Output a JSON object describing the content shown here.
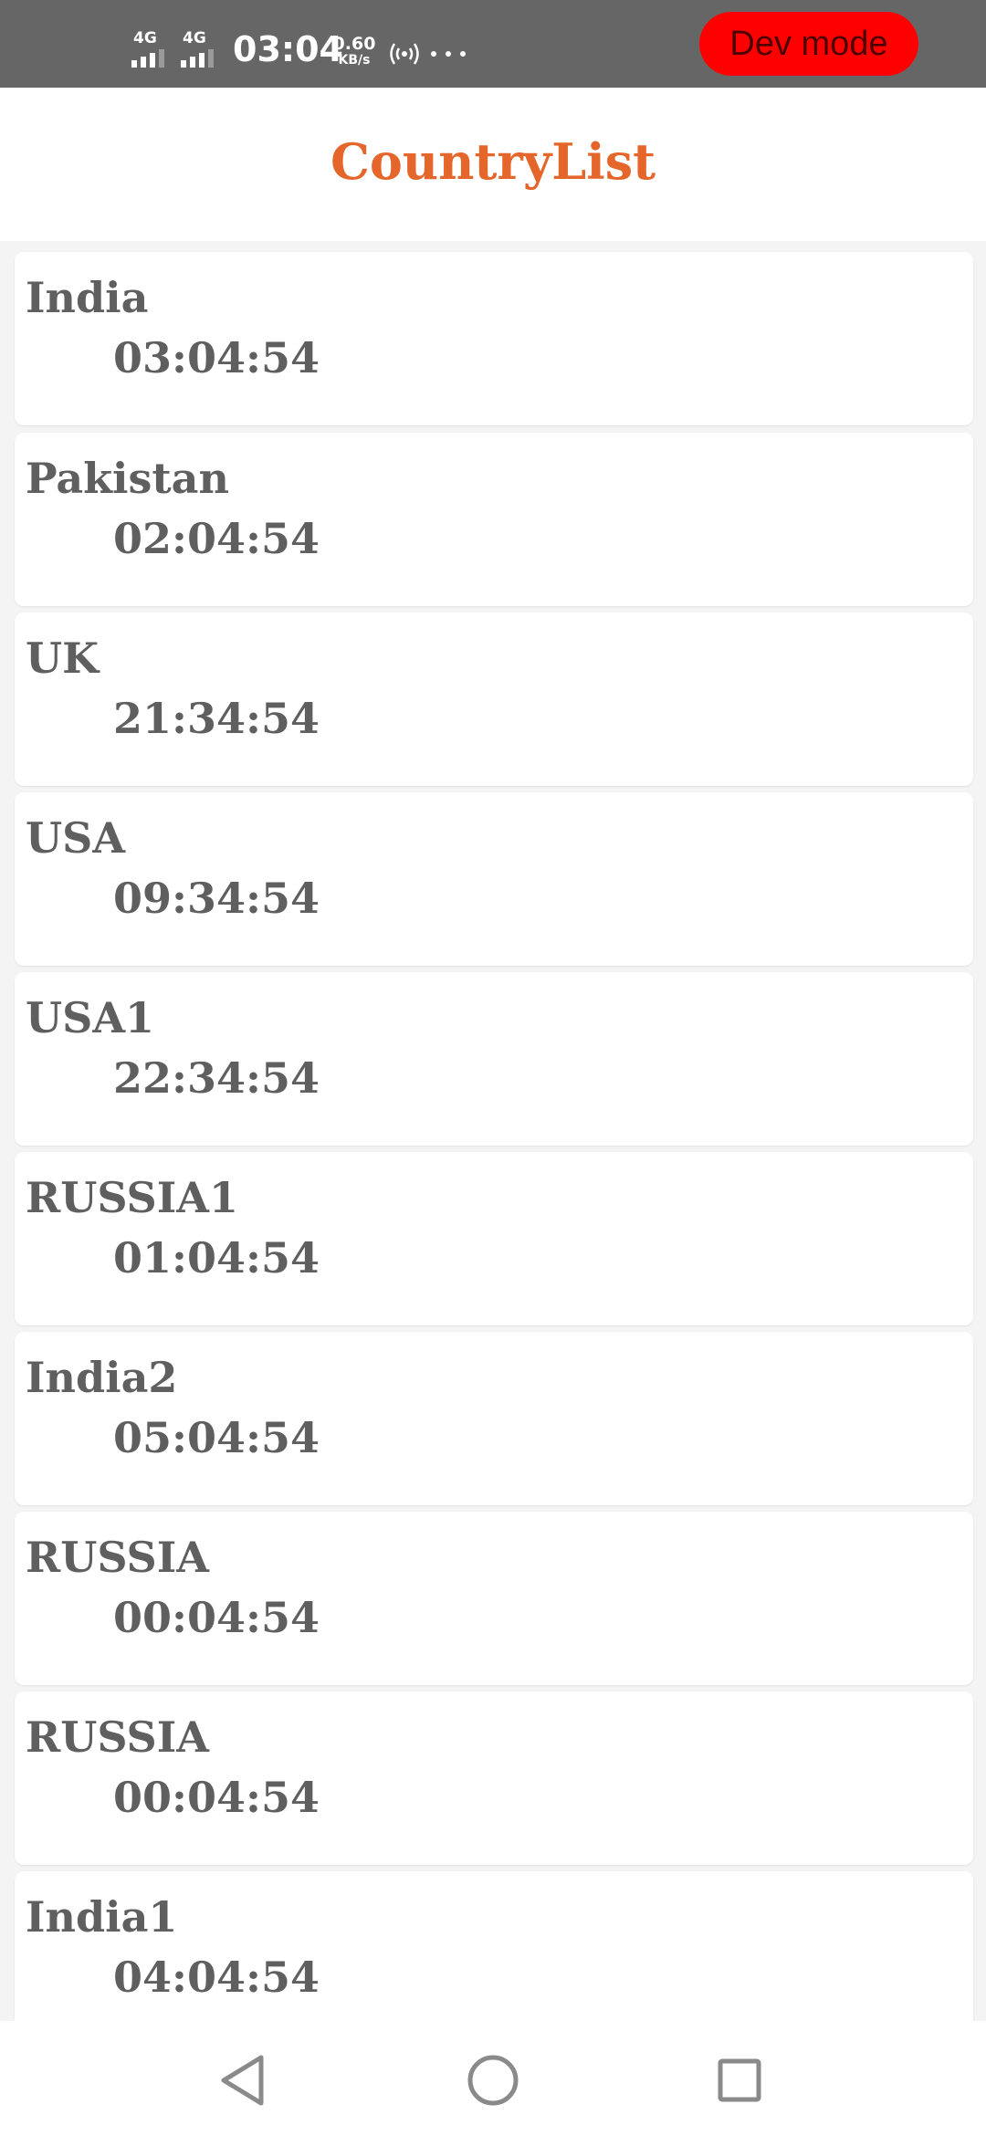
{
  "status_bar": {
    "network": [
      {
        "label": "4G",
        "icon": "signal-icon"
      },
      {
        "label": "4G",
        "icon": "signal-icon"
      }
    ],
    "time": "03:04",
    "speed_value": "0.60",
    "speed_unit": "KB/s",
    "hotspot_icon": "hotspot-icon",
    "more_icon": "more-icon",
    "dev_mode_label": "Dev mode",
    "dev_mode_color": "#ff0000",
    "background_color": "#666666"
  },
  "header": {
    "title": "CountryList",
    "title_color": "#e4662a"
  },
  "countries": [
    {
      "name": "India",
      "time": "03:04:54"
    },
    {
      "name": "Pakistan",
      "time": "02:04:54"
    },
    {
      "name": "UK",
      "time": "21:34:54"
    },
    {
      "name": "USA",
      "time": "09:34:54"
    },
    {
      "name": "USA1",
      "time": "22:34:54"
    },
    {
      "name": "RUSSIA1",
      "time": "01:04:54"
    },
    {
      "name": "India2",
      "time": "05:04:54"
    },
    {
      "name": "RUSSIA",
      "time": "00:04:54"
    },
    {
      "name": "RUSSIA",
      "time": "00:04:54"
    },
    {
      "name": "India1",
      "time": "04:04:54"
    }
  ],
  "nav_bar": {
    "back_icon": "back-triangle-icon",
    "home_icon": "home-circle-icon",
    "recents_icon": "recents-square-icon"
  }
}
